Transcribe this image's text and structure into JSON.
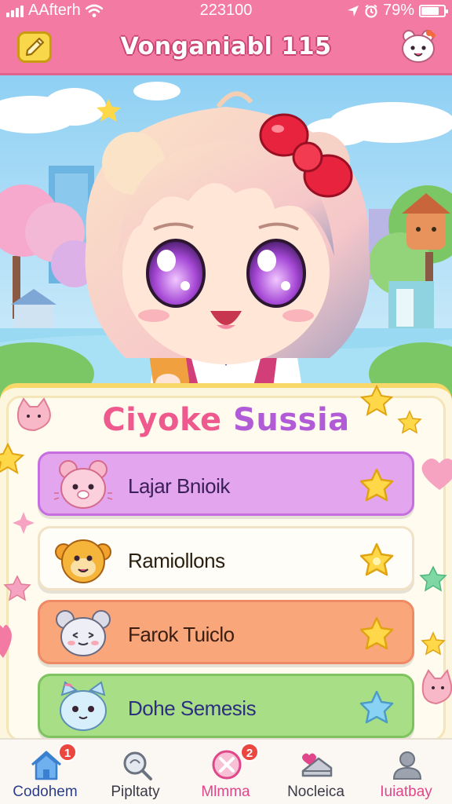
{
  "status_bar": {
    "carrier": "AAfterh",
    "time": "223100",
    "battery": "79%",
    "battery_level": 0.79
  },
  "header": {
    "title": "Vonganiabl 115",
    "left_icon": "pencil-icon",
    "right_icon": "mascot-icon"
  },
  "panel": {
    "title_part1": "Ciyoke",
    "title_part2": "Sussia",
    "items": [
      {
        "label": "Lajar Bnioik",
        "icon": "pink-bear-icon",
        "color": "#e3a5ee"
      },
      {
        "label": "Ramiollons",
        "icon": "orange-monkey-icon",
        "color": "#fffdf7"
      },
      {
        "label": "Farok Tuiclo",
        "icon": "grey-mouse-icon",
        "color": "#f9a67b"
      },
      {
        "label": "Dohe Semesis",
        "icon": "blue-cat-icon",
        "color": "#a8df86"
      }
    ]
  },
  "nav": {
    "items": [
      {
        "label": "Codohem",
        "icon": "home-icon",
        "badge": "1",
        "color": "#2c3e8a"
      },
      {
        "label": "Pipltaty",
        "icon": "magnifier-icon",
        "badge": "",
        "color": "#3a3a48"
      },
      {
        "label": "Mlmma",
        "icon": "cross-circle-icon",
        "badge": "2",
        "color": "#e0478a"
      },
      {
        "label": "Nocleica",
        "icon": "cake-icon",
        "badge": "",
        "color": "#3a3a48"
      },
      {
        "label": "Iuiatbay",
        "icon": "user-icon",
        "badge": "",
        "color": "#e0478a"
      }
    ]
  },
  "colors": {
    "header_pink": "#f27aa3",
    "title_pink": "#ee5a8d",
    "title_purple": "#b15cd6",
    "panel_cream": "#fdf6df"
  }
}
